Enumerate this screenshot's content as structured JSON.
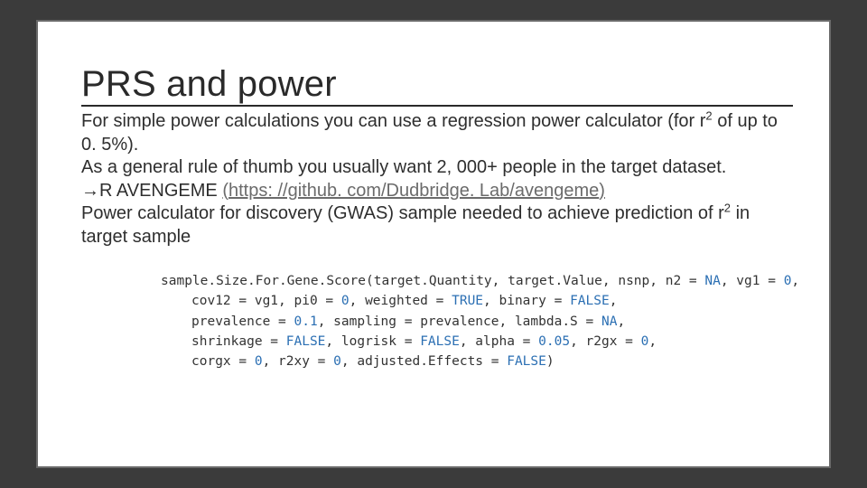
{
  "title": "PRS and power",
  "para1a": "For simple power calculations you can use a regression power calculator (for r",
  "para1b": " of up to 0. 5%).",
  "para2": "As a general rule of thumb you usually want 2, 000+ people in the target dataset.",
  "arrow": "→",
  "tool_label": "R AVENGEME ",
  "tool_url_open": "(",
  "tool_url": "https: //github. com/Dudbridge. Lab/avengeme",
  "tool_url_close": ")",
  "para3a": "Power calculator for discovery (GWAS) sample needed to achieve prediction of r",
  "para3b": " in target sample",
  "sup2": "2",
  "code": {
    "fn": "sample.Size.For.Gene.Score",
    "l1_args": "(target.Quantity, target.Value, nsnp, n2 = ",
    "na": "NA",
    "l1_tail": ", vg1 = ",
    "zero": "0",
    "comma": ",",
    "l2_a": "cov12 = vg1, pi0 = ",
    "l2_b": ", weighted = ",
    "true": "TRUE",
    "l2_c": ", binary = ",
    "false": "FALSE",
    "l3_a": "prevalence = ",
    "p0_1": "0.1",
    "l3_b": ", sampling = prevalence, lambda.S = ",
    "l4_a": "shrinkage = ",
    "l4_b": ", logrisk = ",
    "l4_c": ", alpha = ",
    "p0_05": "0.05",
    "l4_d": ", r2gx = ",
    "l5_a": "corgx = ",
    "l5_b": ", r2xy = ",
    "l5_c": ", adjusted.Effects = ",
    "rparen": ")"
  }
}
